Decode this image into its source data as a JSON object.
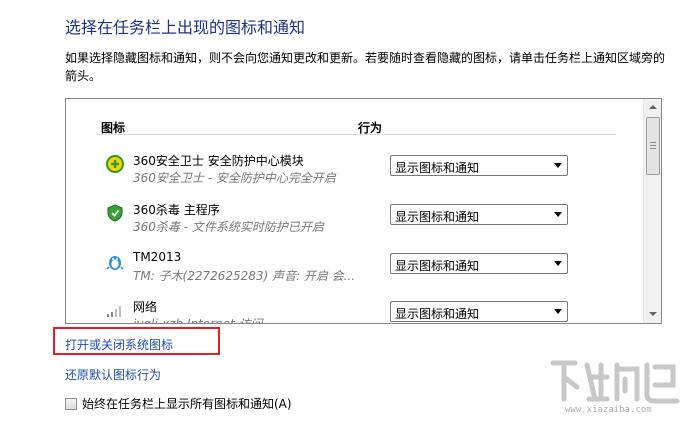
{
  "page_title": "选择在任务栏上出现的图标和通知",
  "description": "如果选择隐藏图标和通知，则不会向您通知更改和更新。若要随时查看隐藏的图标，请单击任务栏上通知区域旁的箭头。",
  "table": {
    "header_icon": "图标",
    "header_action": "行为",
    "rows": [
      {
        "name": "360安全卫士 安全防护中心模块",
        "subtitle": "360安全卫士 - 安全防护中心完全开启",
        "action": "显示图标和通知",
        "icon": "360-safeguard-icon"
      },
      {
        "name": "360杀毒 主程序",
        "subtitle": "360杀毒 - 文件系统实时防护已开启",
        "action": "显示图标和通知",
        "icon": "360-antivirus-shield-icon"
      },
      {
        "name": "TM2013",
        "subtitle": "TM: 子木(2272625283)  声音: 开启  会...",
        "action": "显示图标和通知",
        "icon": "tm-qq-penguin-icon"
      },
      {
        "name": "网络",
        "subtitle": "jyqlj-xzb Internet 访问",
        "action": "显示图标和通知",
        "icon": "network-signal-icon"
      }
    ]
  },
  "links": {
    "toggle_system_icons": "打开或关闭系统图标",
    "restore_defaults": "还原默认图标行为"
  },
  "checkbox": {
    "label": "始终在任务栏上显示所有图标和通知(A)",
    "checked": false
  },
  "watermark": {
    "url": "www.xiazaiba.com"
  },
  "colors": {
    "title": "#1e3287",
    "link": "#1e4fa8",
    "highlight_box": "#e31e24"
  }
}
